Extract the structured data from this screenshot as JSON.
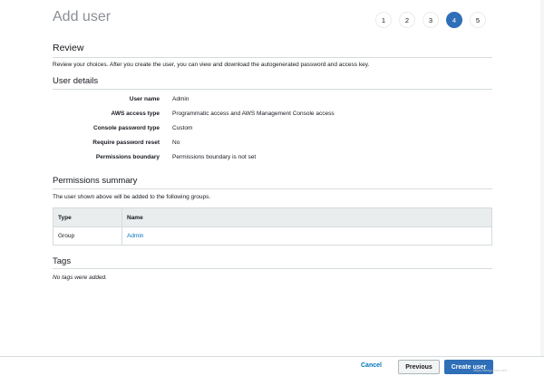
{
  "page": {
    "title": "Add user"
  },
  "steps": [
    {
      "label": "1",
      "active": false
    },
    {
      "label": "2",
      "active": false
    },
    {
      "label": "3",
      "active": false
    },
    {
      "label": "4",
      "active": true
    },
    {
      "label": "5",
      "active": false
    }
  ],
  "review": {
    "title": "Review",
    "description": "Review your choices. After you create the user, you can view and download the autogenerated password and access key."
  },
  "user_details": {
    "title": "User details",
    "rows": [
      {
        "label": "User name",
        "value": "Admin"
      },
      {
        "label": "AWS access type",
        "value": "Programmatic access and AWS Management Console access"
      },
      {
        "label": "Console password type",
        "value": "Custom"
      },
      {
        "label": "Require password reset",
        "value": "No"
      },
      {
        "label": "Permissions boundary",
        "value": "Permissions boundary is not set"
      }
    ]
  },
  "permissions": {
    "title": "Permissions summary",
    "description": "The user shown above will be added to the following groups.",
    "columns": [
      "Type",
      "Name"
    ],
    "rows": [
      {
        "type": "Group",
        "name": "Admin"
      }
    ]
  },
  "tags": {
    "title": "Tags",
    "empty_text": "No tags were added."
  },
  "footer": {
    "cancel_label": "Cancel",
    "previous_label": "Previous",
    "create_label": "Create user",
    "watermark": "https://blog.csdn.net/..."
  },
  "colors": {
    "accent": "#2f6fb8",
    "link": "#0073bb",
    "border": "#d5dbdb",
    "table_header": "#eaeded"
  }
}
